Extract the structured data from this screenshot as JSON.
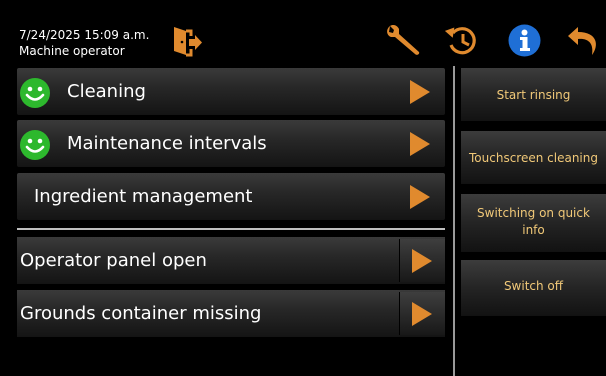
{
  "header": {
    "datetime": "7/24/2025 15:09 a.m.",
    "role": "Machine operator",
    "icons": [
      "exit-door-icon",
      "wrench-icon",
      "history-icon",
      "info-icon",
      "back-icon"
    ]
  },
  "menu": {
    "items": [
      {
        "label": "Cleaning",
        "status_icon": "smiley-icon",
        "status_color": "#2db82d"
      },
      {
        "label": "Maintenance intervals",
        "status_icon": "smiley-icon",
        "status_color": "#2db82d"
      },
      {
        "label": "Ingredient management"
      }
    ]
  },
  "messages": {
    "items": [
      {
        "label": "Operator panel open"
      },
      {
        "label": "Grounds container missing"
      }
    ]
  },
  "sidebar": {
    "buttons": [
      {
        "label": "Start rinsing"
      },
      {
        "label": "Touchscreen cleaning"
      },
      {
        "label": "Switching on quick info"
      },
      {
        "label": "Switch off"
      }
    ]
  },
  "colors": {
    "accent_arrow": "#e08a2e",
    "info_blue": "#1f6fd6",
    "button_text": "#f0c878",
    "status_ok": "#2db82d"
  }
}
